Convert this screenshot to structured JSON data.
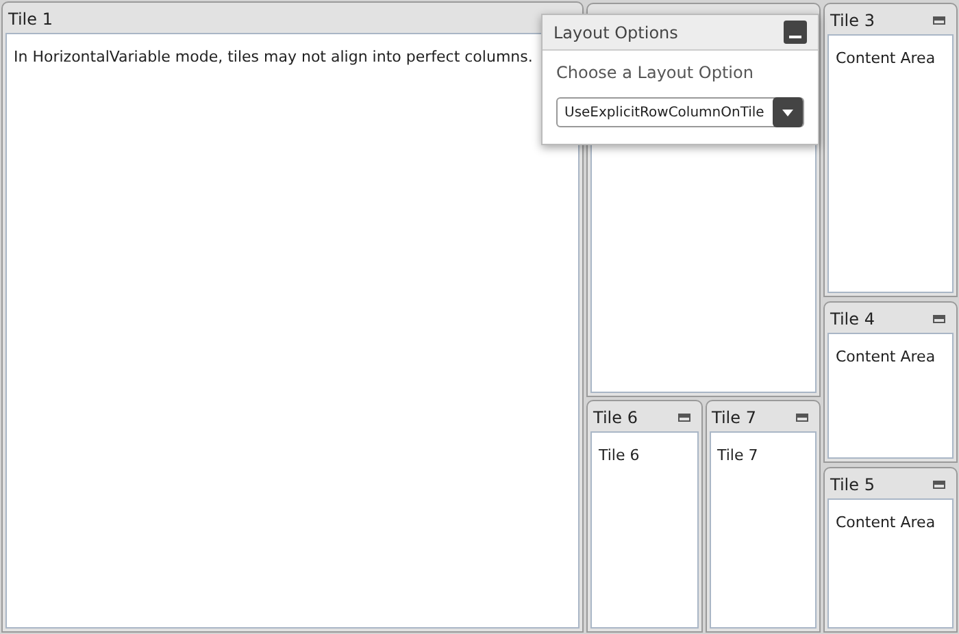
{
  "tiles": [
    {
      "kind": "tile",
      "title": "Tile 1",
      "content": "In HorizontalVariable mode, tiles may not align into perfect columns."
    },
    {
      "kind": "tile"
    },
    {
      "kind": "tile",
      "title": "Tile 3",
      "content": "Content Area"
    },
    {
      "kind": "tile",
      "title": "Tile 4",
      "content": "Content Area"
    },
    {
      "kind": "tile",
      "title": "Tile 5",
      "content": "Content Area"
    },
    {
      "kind": "tile",
      "title": "Tile 6",
      "content": "Tile 6"
    },
    {
      "kind": "tile",
      "title": "Tile 7",
      "content": "Tile 7"
    }
  ],
  "layout_options": {
    "title": "Layout Options",
    "label": "Choose a Layout Option",
    "value": "UseExplicitRowColumnOnTile"
  }
}
